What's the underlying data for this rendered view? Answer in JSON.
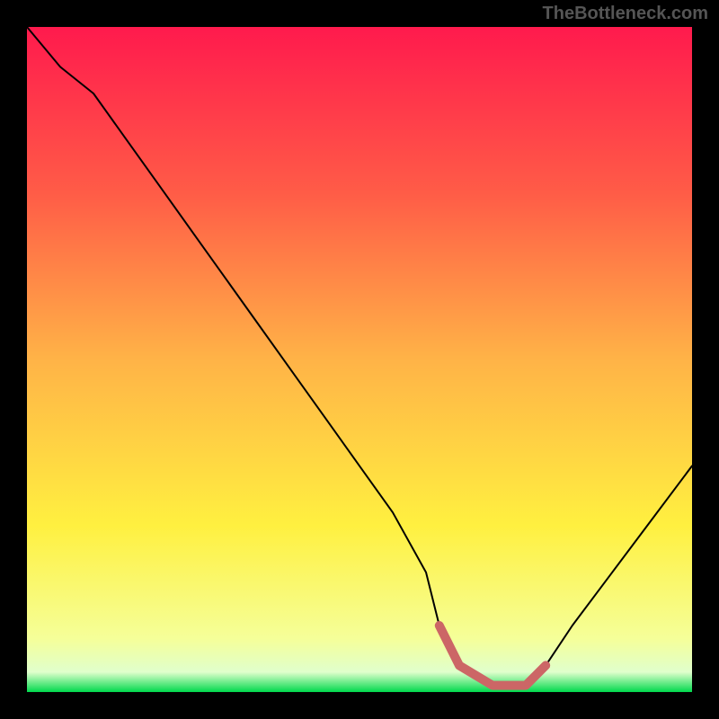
{
  "watermark": "TheBottleneck.com",
  "chart_data": {
    "type": "line",
    "title": "",
    "xlabel": "",
    "ylabel": "",
    "xlim": [
      0,
      100
    ],
    "ylim": [
      0,
      100
    ],
    "grid": false,
    "series": [
      {
        "name": "bottleneck-curve",
        "x": [
          0,
          5,
          10,
          15,
          20,
          25,
          30,
          35,
          40,
          45,
          50,
          55,
          60,
          62,
          65,
          70,
          75,
          78,
          82,
          88,
          94,
          100
        ],
        "values": [
          100,
          94,
          90,
          83,
          76,
          69,
          62,
          55,
          48,
          41,
          34,
          27,
          18,
          10,
          4,
          1,
          1,
          4,
          10,
          18,
          26,
          34
        ],
        "stroke": "#000000",
        "stroke_width": 2
      },
      {
        "name": "optimal-band",
        "x": [
          62,
          65,
          70,
          75,
          78
        ],
        "values": [
          10,
          4,
          1,
          1,
          4
        ],
        "stroke": "#cc6666",
        "stroke_width": 10
      }
    ],
    "background_gradient": {
      "type": "vertical",
      "stops": [
        {
          "offset": 0.0,
          "color": "#ff1a4d"
        },
        {
          "offset": 0.25,
          "color": "#ff5c47"
        },
        {
          "offset": 0.5,
          "color": "#ffb347"
        },
        {
          "offset": 0.75,
          "color": "#fff040"
        },
        {
          "offset": 0.92,
          "color": "#f5ff99"
        },
        {
          "offset": 0.97,
          "color": "#e0ffcc"
        },
        {
          "offset": 1.0,
          "color": "#00d94d"
        }
      ]
    }
  }
}
